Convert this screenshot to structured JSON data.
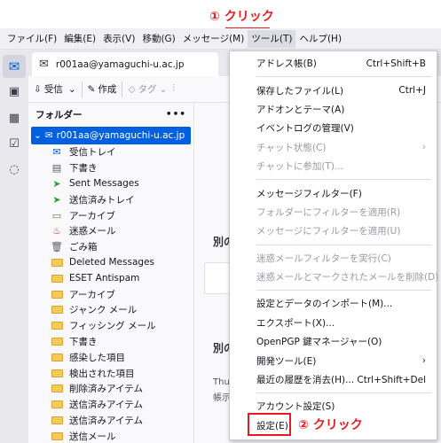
{
  "annotations": {
    "step1": "① クリック",
    "step2": "② クリック"
  },
  "menubar": [
    "ファイル(F)",
    "編集(E)",
    "表示(V)",
    "移動(G)",
    "メッセージ(M)",
    "ツール(T)",
    "ヘルプ(H)"
  ],
  "tab": {
    "title": "r001aa@yamaguchi-u.ac.jp"
  },
  "toolbar": {
    "receive": "受信",
    "compose": "作成",
    "tag": "タグ"
  },
  "folder_pane": {
    "header": "フォルダー",
    "menu": "•••",
    "account": "r001aa@yamaguchi-u.ac.jp",
    "folders": [
      {
        "label": "受信トレイ",
        "icon": "inbox-icon"
      },
      {
        "label": "下書き",
        "icon": "drafts-icon"
      },
      {
        "label": "Sent Messages",
        "icon": "sent-icon"
      },
      {
        "label": "送信済みトレイ",
        "icon": "sent-icon"
      },
      {
        "label": "アーカイブ",
        "icon": "archive-icon"
      },
      {
        "label": "迷惑メール",
        "icon": "junk-icon"
      },
      {
        "label": "ごみ箱",
        "icon": "trash-icon"
      },
      {
        "label": "Deleted Messages",
        "icon": "folder-icon"
      },
      {
        "label": "ESET Antispam",
        "icon": "folder-icon"
      },
      {
        "label": "アーカイブ",
        "icon": "folder-icon"
      },
      {
        "label": "ジャンク メール",
        "icon": "folder-icon"
      },
      {
        "label": "フィッシング メール",
        "icon": "folder-icon"
      },
      {
        "label": "下書き",
        "icon": "folder-icon"
      },
      {
        "label": "感染した項目",
        "icon": "folder-icon"
      },
      {
        "label": "検出された項目",
        "icon": "folder-icon"
      },
      {
        "label": "削除済みアイテム",
        "icon": "folder-icon"
      },
      {
        "label": "送信済みアイテム",
        "icon": "folder-icon"
      },
      {
        "label": "送信済みアイテム",
        "icon": "folder-icon"
      },
      {
        "label": "送信メール",
        "icon": "folder-icon"
      }
    ]
  },
  "message_area": {
    "text1": "別の",
    "text2": "別の",
    "small1": "Thu",
    "small2": "帳示"
  },
  "tools_menu": {
    "items": [
      {
        "label": "アドレス帳(B)",
        "shortcut": "Ctrl+Shift+B",
        "disabled": false
      },
      {
        "sep": true
      },
      {
        "label": "保存したファイル(L)",
        "shortcut": "Ctrl+J",
        "disabled": false
      },
      {
        "label": "アドオンとテーマ(A)",
        "shortcut": "",
        "disabled": false
      },
      {
        "label": "イベントログの管理(V)",
        "shortcut": "",
        "disabled": false
      },
      {
        "label": "チャット状態(C)",
        "shortcut": "›",
        "disabled": true
      },
      {
        "label": "チャットに参加(T)...",
        "shortcut": "",
        "disabled": true
      },
      {
        "sep": true
      },
      {
        "label": "メッセージフィルター(F)",
        "shortcut": "",
        "disabled": false
      },
      {
        "label": "フォルダーにフィルターを適用(R)",
        "shortcut": "",
        "disabled": true
      },
      {
        "label": "メッセージにフィルターを適用(U)",
        "shortcut": "",
        "disabled": true
      },
      {
        "sep": true
      },
      {
        "label": "迷惑メールフィルターを実行(C)",
        "shortcut": "",
        "disabled": true
      },
      {
        "label": "迷惑メールとマークされたメールを削除(D)",
        "shortcut": "",
        "disabled": true
      },
      {
        "sep": true
      },
      {
        "label": "設定とデータのインポート(M)...",
        "shortcut": "",
        "disabled": false
      },
      {
        "label": "エクスポート(X)...",
        "shortcut": "",
        "disabled": false
      },
      {
        "label": "OpenPGP 鍵マネージャー(O)",
        "shortcut": "",
        "disabled": false
      },
      {
        "label": "開発ツール(E)",
        "shortcut": "›",
        "disabled": false
      },
      {
        "label": "最近の履歴を消去(H)...",
        "shortcut": "Ctrl+Shift+Del",
        "disabled": false
      },
      {
        "sep": true
      },
      {
        "label": "アカウント設定(S)",
        "shortcut": "",
        "disabled": false
      },
      {
        "label": "設定(E)",
        "shortcut": "",
        "disabled": false
      }
    ]
  },
  "colors": {
    "accent": "#0060df",
    "annotation": "#e8191f"
  }
}
